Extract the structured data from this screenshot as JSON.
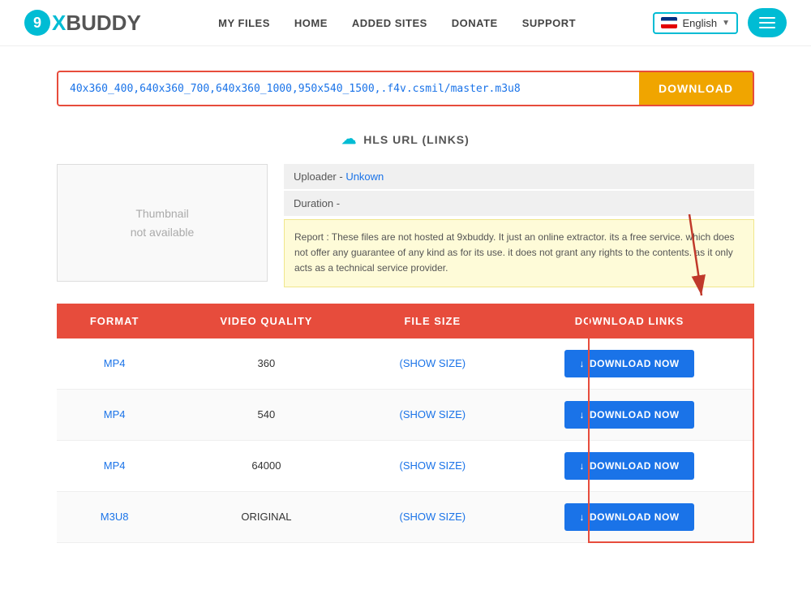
{
  "header": {
    "logo": {
      "nine": "9",
      "x": "X",
      "buddy": "BUDDY"
    },
    "nav": {
      "my_files": "MY FILES",
      "home": "HOME",
      "added_sites": "ADDED SITES",
      "donate": "DONATE",
      "support": "SUPPORT"
    },
    "language": {
      "selected": "English",
      "label": "English"
    }
  },
  "url_bar": {
    "value": "40x360_400,640x360_700,640x360_1000,950x540_1500,.f4v.csmil/master.m3u8",
    "download_label": "DOWNLOAD"
  },
  "hls_section": {
    "title": "HLS URL (LINKS)"
  },
  "info": {
    "uploader_label": "Uploader - ",
    "uploader_value": "Unkown",
    "duration_label": "Duration - ",
    "thumbnail_text": "Thumbnail\nnot available",
    "report": "Report : These files are not hosted at 9xbuddy. It just an online extractor. its a free service. which does not offer any guarantee of any kind as for its use. it does not grant any rights to the contents. as it only acts as a technical service provider."
  },
  "table": {
    "headers": [
      "FORMAT",
      "VIDEO QUALITY",
      "FILE SIZE",
      "DOWNLOAD LINKS"
    ],
    "rows": [
      {
        "format": "MP4",
        "quality": "360",
        "size": "(SHOW SIZE)",
        "action": "DOWNLOAD NOW"
      },
      {
        "format": "MP4",
        "quality": "540",
        "size": "(SHOW SIZE)",
        "action": "DOWNLOAD NOW"
      },
      {
        "format": "MP4",
        "quality": "64000",
        "size": "(SHOW SIZE)",
        "action": "DOWNLOAD NOW"
      },
      {
        "format": "M3U8",
        "quality": "ORIGINAL",
        "size": "(SHOW SIZE)",
        "action": "DOWNLOAD NOW"
      }
    ]
  }
}
